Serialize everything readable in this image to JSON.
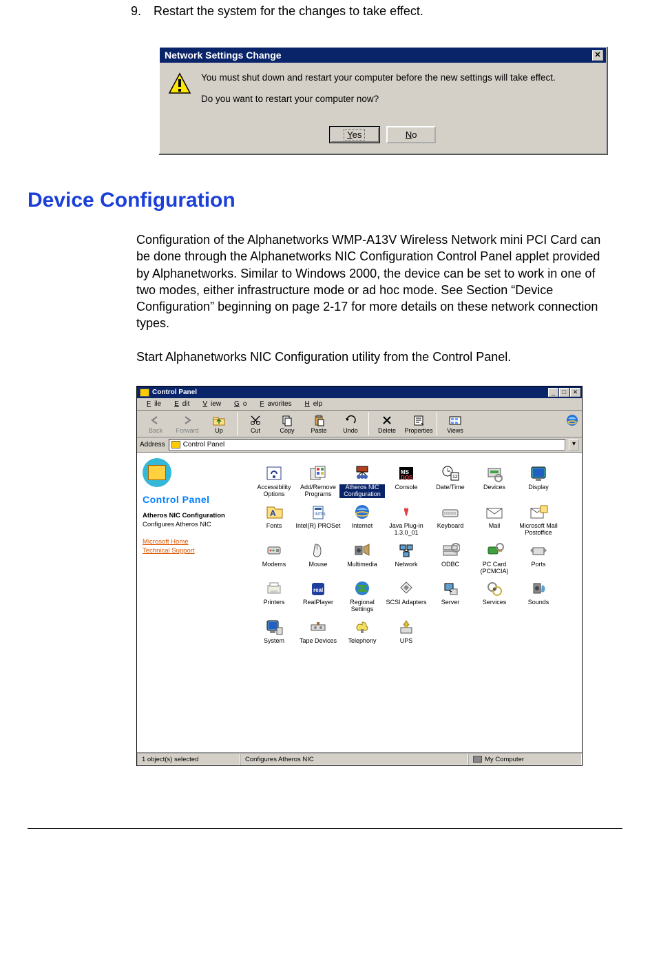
{
  "step": {
    "num": "9.",
    "text": "Restart the system for the changes to take effect."
  },
  "dialog1": {
    "title": "Network Settings Change",
    "line1": "You must shut down and restart your computer before the new settings will take effect.",
    "line2": "Do you want to restart your computer now?",
    "yes": "Yes",
    "no": "No"
  },
  "section_heading": "Device Configuration",
  "para1": "Configuration of the Alphanetworks WMP-A13V Wireless Network mini PCI Card can be done through the Alphanetworks NIC Configuration Control Panel applet provided by Alphanetworks. Similar to Windows 2000, the device can be set to work in one of two modes, either infrastructure mode or ad hoc mode. See Section “Device Configuration” beginning on page 2-17 for more details on these network connection types.",
  "para2": "Start Alphanetworks NIC Configuration utility from the Control Panel.",
  "cp": {
    "title": "Control Panel",
    "menus": [
      "File",
      "Edit",
      "View",
      "Go",
      "Favorites",
      "Help"
    ],
    "toolbar": [
      {
        "label": "Back",
        "icon": "arrow-left",
        "disabled": true
      },
      {
        "label": "Forward",
        "icon": "arrow-right",
        "disabled": true
      },
      {
        "label": "Up",
        "icon": "folder-up",
        "disabled": false
      },
      {
        "label": "Cut",
        "icon": "scissors",
        "disabled": false
      },
      {
        "label": "Copy",
        "icon": "copy",
        "disabled": false
      },
      {
        "label": "Paste",
        "icon": "paste",
        "disabled": false
      },
      {
        "label": "Undo",
        "icon": "undo",
        "disabled": false
      },
      {
        "label": "Delete",
        "icon": "delete",
        "disabled": false
      },
      {
        "label": "Properties",
        "icon": "properties",
        "disabled": false
      },
      {
        "label": "Views",
        "icon": "views",
        "disabled": false
      }
    ],
    "address_label": "Address",
    "address_value": "Control Panel",
    "side_title": "Control Panel",
    "side_selected": "Atheros NIC Configuration",
    "side_desc": "Configures Atheros NIC",
    "side_links": [
      "Microsoft Home",
      "Technical Support"
    ],
    "items": [
      "Accessibility Options",
      "Add/Remove Programs",
      "Atheros NIC Configuration",
      "Console",
      "Date/Time",
      "Devices",
      "Display",
      "Fonts",
      "Intel(R) PROSet",
      "Internet",
      "Java Plug-in 1.3.0_01",
      "Keyboard",
      "Mail",
      "Microsoft Mail Postoffice",
      "Modems",
      "Mouse",
      "Multimedia",
      "Network",
      "ODBC",
      "PC Card (PCMCIA)",
      "Ports",
      "Printers",
      "RealPlayer",
      "Regional Settings",
      "SCSI Adapters",
      "Server",
      "Services",
      "Sounds",
      "System",
      "Tape Devices",
      "Telephony",
      "UPS"
    ],
    "selected_index": 2,
    "status": {
      "left": "1 object(s) selected",
      "mid": "Configures Atheros NIC",
      "right": "My Computer"
    }
  }
}
